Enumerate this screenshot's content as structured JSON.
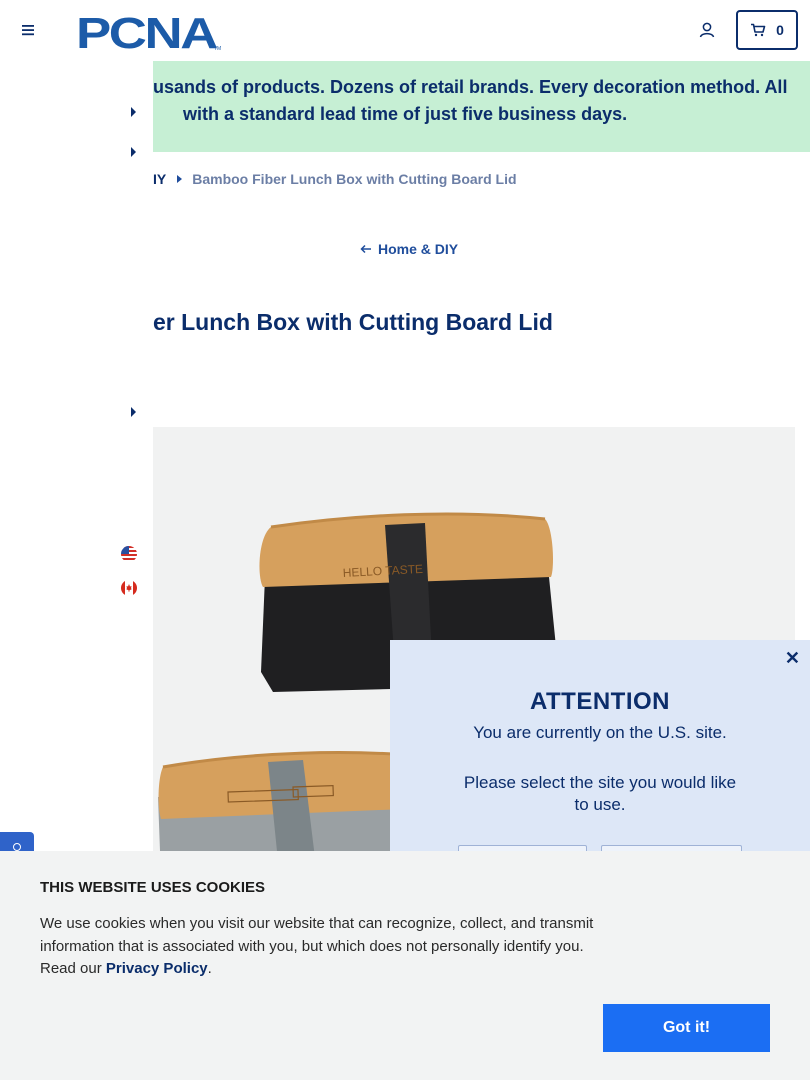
{
  "header": {
    "logo_text": "PCNA",
    "logo_tm": "TM",
    "cart_count": "0"
  },
  "banner": {
    "line1": "usands of products. Dozens of retail brands. Every decoration method. All",
    "line2": "with a standard lead time of just five business days."
  },
  "breadcrumb": {
    "parent": "IY",
    "current": "Bamboo Fiber Lunch Box with Cutting Board Lid"
  },
  "back_link": "Home & DIY",
  "product": {
    "title": "er Lunch Box with Cutting Board Lid",
    "lid_engraving": "HELLO TASTE"
  },
  "attention": {
    "title": "ATTENTION",
    "current_site": "You are currently on the U.S. site.",
    "prompt": "Please select the site you would like to use."
  },
  "cookie": {
    "title": "THIS WEBSITE USES COOKIES",
    "text": "We use cookies when you visit our website that can recognize, collect, and transmit information that is associated with you, but which does not personally identify you. Read our",
    "link": "Privacy Policy",
    "period": ".",
    "button": "Got it!"
  },
  "colors": {
    "brand_navy": "#0b2d6b",
    "brand_blue": "#1f4d9c",
    "banner_green": "#c6efd4",
    "attention_bg": "#dde7f7",
    "cookie_button": "#1b6ef3"
  },
  "icons": [
    "menu-icon",
    "account-icon",
    "cart-icon",
    "chevron-right-icon",
    "arrow-left-icon",
    "us-flag-icon",
    "canada-flag-icon",
    "close-icon"
  ]
}
